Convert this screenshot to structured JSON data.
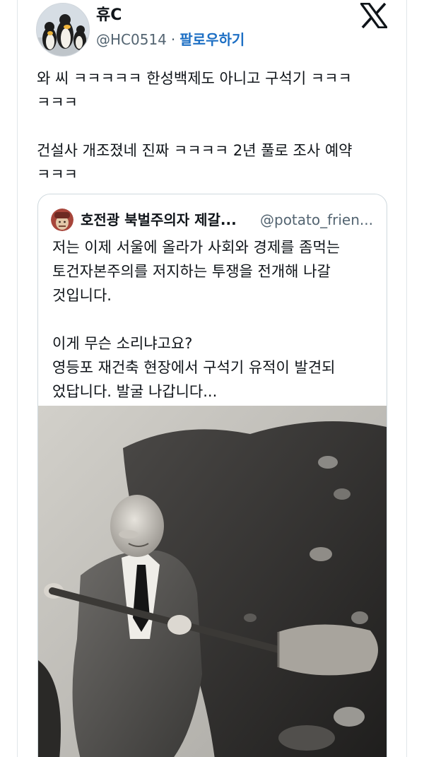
{
  "author": {
    "display_name": "휴C",
    "handle": "@HC0514",
    "separator": "·",
    "follow_label": "팔로우하기"
  },
  "brand": {
    "icon": "x-logo-icon"
  },
  "tweet": {
    "text": "와 씨 ㅋㅋㅋㅋㅋ 한성백제도 아니고 구석기 ㅋㅋㅋ\nㅋㅋㅋ\n\n건설사 개조졌네 진짜 ㅋㅋㅋㅋ 2년 풀로 조사 예약\nㅋㅋㅋ"
  },
  "quoted_tweet": {
    "display_name": "호전광 북벌주의자 제갈...",
    "handle": "@potato_frien...",
    "text": "저는 이제 서울에 올라가 사회와 경제를 좀먹는\n토건자본주의를 저지하는 투쟁을 전개해 나갈\n것입니다.\n\n이게 무슨 소리냐고요?\n영등포 재건축 현장에서 구석기 유적이 발견되\n었답니다. 발굴 나갑니다..."
  },
  "colors": {
    "text": "#0f1419",
    "secondary": "#536471",
    "link": "#1d6fc4",
    "border": "#cfd9de"
  }
}
